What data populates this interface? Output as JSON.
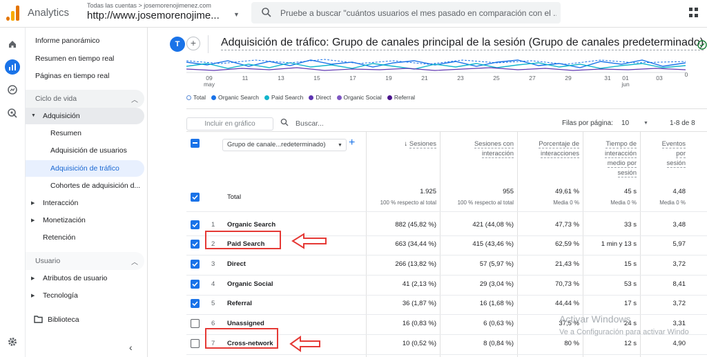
{
  "app": {
    "name": "Analytics"
  },
  "account": {
    "crumb": "Todas las cuentas > josemorenojimenez.com",
    "property": "http://www.josemorenojime..."
  },
  "search": {
    "placeholder": "Pruebe a buscar \"cuántos usuarios el mes pasado en comparación con el ..."
  },
  "nav": {
    "overview": "Informe panorámico",
    "realtime": "Resumen en tiempo real",
    "realtime_pages": "Páginas en tiempo real",
    "lifecycle": "Ciclo de vida",
    "acquisition": "Adquisición",
    "acq_items": [
      "Resumen",
      "Adquisición de usuarios",
      "Adquisición de tráfico",
      "Cohortes de adquisición d..."
    ],
    "engagement": "Interacción",
    "monetization": "Monetización",
    "retention": "Retención",
    "user": "Usuario",
    "user_attrs": "Atributos de usuario",
    "tech": "Tecnología",
    "library": "Biblioteca"
  },
  "report": {
    "avatar": "T",
    "title": "Adquisición de tráfico: Grupo de canales principal de la sesión (Grupo de canales predeterminado)"
  },
  "chart": {
    "x_ticks": [
      "09",
      "11",
      "13",
      "15",
      "17",
      "19",
      "21",
      "23",
      "25",
      "27",
      "29",
      "31",
      "01",
      "03"
    ],
    "x_sub": [
      "may",
      "jun"
    ],
    "y_tick": "0",
    "legend": [
      {
        "label": "Total",
        "color": "#ffffff"
      },
      {
        "label": "Organic Search",
        "color": "#1a73e8"
      },
      {
        "label": "Paid Search",
        "color": "#12b5cb"
      },
      {
        "label": "Direct",
        "color": "#5e35b1"
      },
      {
        "label": "Organic Social",
        "color": "#7e57c2"
      },
      {
        "label": "Referral",
        "color": "#4a148c"
      }
    ]
  },
  "toolbar": {
    "include": "Incluir en gráfico",
    "search": "Buscar...",
    "rows_label": "Filas por página:",
    "rows_value": "10",
    "pager": "1-8 de 8"
  },
  "table": {
    "dim_selector": "Grupo de canale...redeterminado)",
    "headers": {
      "sessions": "Sesiones",
      "engaged": [
        "Sesiones con",
        "interacción"
      ],
      "rate": [
        "Porcentaje de",
        "interacciones"
      ],
      "time": [
        "Tiempo de",
        "interacción",
        "medio por",
        "sesión"
      ],
      "events": [
        "Eventos",
        "por",
        "sesión"
      ]
    },
    "total": {
      "label": "Total",
      "sessions": "1.925",
      "sessions_sub": "100 % respecto al total",
      "engaged": "955",
      "engaged_sub": "100 % respecto al total",
      "rate": "49,61 %",
      "rate_sub": "Media 0 %",
      "time": "45 s",
      "time_sub": "Media 0 %",
      "events": "4,48",
      "events_sub": "Media 0 %"
    },
    "rows": [
      {
        "idx": "1",
        "name": "Organic Search",
        "sessions": "882 (45,82 %)",
        "engaged": "421 (44,08 %)",
        "rate": "47,73 %",
        "time": "33 s",
        "events": "3,48",
        "checked": true
      },
      {
        "idx": "2",
        "name": "Paid Search",
        "sessions": "663 (34,44 %)",
        "engaged": "415 (43,46 %)",
        "rate": "62,59 %",
        "time": "1 min y 13 s",
        "events": "5,97",
        "checked": true
      },
      {
        "idx": "3",
        "name": "Direct",
        "sessions": "266 (13,82 %)",
        "engaged": "57 (5,97 %)",
        "rate": "21,43 %",
        "time": "15 s",
        "events": "3,72",
        "checked": true
      },
      {
        "idx": "4",
        "name": "Organic Social",
        "sessions": "41 (2,13 %)",
        "engaged": "29 (3,04 %)",
        "rate": "70,73 %",
        "time": "53 s",
        "events": "8,41",
        "checked": true
      },
      {
        "idx": "5",
        "name": "Referral",
        "sessions": "36 (1,87 %)",
        "engaged": "16 (1,68 %)",
        "rate": "44,44 %",
        "time": "17 s",
        "events": "3,72",
        "checked": true
      },
      {
        "idx": "6",
        "name": "Unassigned",
        "sessions": "16 (0,83 %)",
        "engaged": "6 (0,63 %)",
        "rate": "37,5 %",
        "time": "24 s",
        "events": "3,31",
        "checked": false
      },
      {
        "idx": "7",
        "name": "Cross-network",
        "sessions": "10 (0,52 %)",
        "engaged": "8 (0,84 %)",
        "rate": "80 %",
        "time": "12 s",
        "events": "4,90",
        "checked": false
      }
    ]
  },
  "watermark": {
    "line1": "Activar Windows",
    "line2": "Ve a Configuración para activar Windo"
  }
}
